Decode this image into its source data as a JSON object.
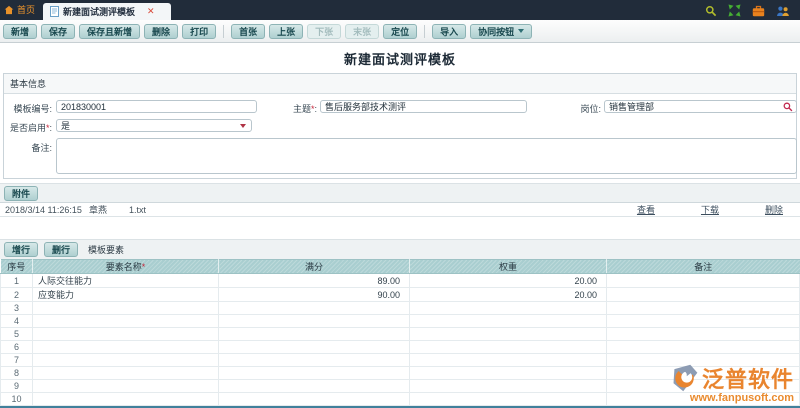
{
  "colors": {
    "tab_bar_bg": "#212c3a",
    "button_teal": "#aecfd0",
    "button_text": "#17474d",
    "table_header_teal": "#a9ced0",
    "grid_bottom_border": "#41809b",
    "required_red": "#c6283c",
    "brand_orange": "#e87b1e",
    "home_orange": "#f0962c"
  },
  "tabbar": {
    "home_label": "首页",
    "active_tab": "新建面试测评模板"
  },
  "toolbar": {
    "items": [
      {
        "label": "新增",
        "name": "add-button",
        "enabled": true
      },
      {
        "label": "保存",
        "name": "save-button",
        "enabled": true
      },
      {
        "label": "保存且新增",
        "name": "save-and-new-button",
        "enabled": true
      },
      {
        "label": "删除",
        "name": "delete-button",
        "enabled": true
      },
      {
        "label": "打印",
        "name": "print-button",
        "enabled": true
      },
      {
        "type": "separator"
      },
      {
        "label": "首张",
        "name": "first-record-button",
        "enabled": true
      },
      {
        "label": "上张",
        "name": "prev-record-button",
        "enabled": true
      },
      {
        "label": "下张",
        "name": "next-record-button",
        "enabled": false
      },
      {
        "label": "末张",
        "name": "last-record-button",
        "enabled": false
      },
      {
        "label": "定位",
        "name": "locate-button",
        "enabled": true
      },
      {
        "type": "separator"
      },
      {
        "label": "导入",
        "name": "import-button",
        "enabled": true
      },
      {
        "label": "协同按钮",
        "name": "collab-button",
        "enabled": true,
        "dropdown": true
      }
    ]
  },
  "page": {
    "title": "新建面试测评模板"
  },
  "basic_info": {
    "section_title": "基本信息",
    "colon": ":",
    "fields": {
      "template_no": {
        "label": "模板编号",
        "required": "",
        "value": "201830001"
      },
      "subject": {
        "label": "主题",
        "required": "*",
        "value": "售后服务部技术测评"
      },
      "position": {
        "label": "岗位",
        "required": "",
        "value": "销售管理部"
      },
      "enabled": {
        "label": "是否启用",
        "required": "*",
        "value": "是"
      },
      "remark": {
        "label": "备注",
        "required": "",
        "value": ""
      }
    }
  },
  "attachment": {
    "button_label": "附件",
    "row": {
      "datetime": "2018/3/14 11:26:15",
      "uploader": "章燕",
      "filename": "1.txt"
    },
    "actions": [
      {
        "label": "查看",
        "name": "view-link"
      },
      {
        "label": "下载",
        "name": "download-link"
      },
      {
        "label": "删除",
        "name": "delete-link"
      }
    ]
  },
  "detail": {
    "add_row_label": "增行",
    "delete_row_label": "删行",
    "section_label": "模板要素",
    "table": {
      "headers": [
        {
          "label": "序号",
          "required": "",
          "name": "col-no"
        },
        {
          "label": "要素名称",
          "required": "*",
          "name": "col-name"
        },
        {
          "label": "满分",
          "required": "",
          "name": "col-score"
        },
        {
          "label": "权重",
          "required": "",
          "name": "col-weight"
        },
        {
          "label": "备注",
          "required": "",
          "name": "col-remark"
        }
      ],
      "rows": [
        {
          "no": "1",
          "name": "人际交往能力",
          "score": "89.00",
          "weight": "20.00",
          "remark": ""
        },
        {
          "no": "2",
          "name": "应变能力",
          "score": "90.00",
          "weight": "20.00",
          "remark": ""
        },
        {
          "no": "3",
          "name": "",
          "score": "",
          "weight": "",
          "remark": ""
        },
        {
          "no": "4",
          "name": "",
          "score": "",
          "weight": "",
          "remark": ""
        },
        {
          "no": "5",
          "name": "",
          "score": "",
          "weight": "",
          "remark": ""
        },
        {
          "no": "6",
          "name": "",
          "score": "",
          "weight": "",
          "remark": ""
        },
        {
          "no": "7",
          "name": "",
          "score": "",
          "weight": "",
          "remark": ""
        },
        {
          "no": "8",
          "name": "",
          "score": "",
          "weight": "",
          "remark": ""
        },
        {
          "no": "9",
          "name": "",
          "score": "",
          "weight": "",
          "remark": ""
        },
        {
          "no": "10",
          "name": "",
          "score": "",
          "weight": "",
          "remark": ""
        }
      ]
    }
  },
  "watermark": {
    "brand": "泛普软件",
    "url": "www.fanpusoft.com"
  }
}
